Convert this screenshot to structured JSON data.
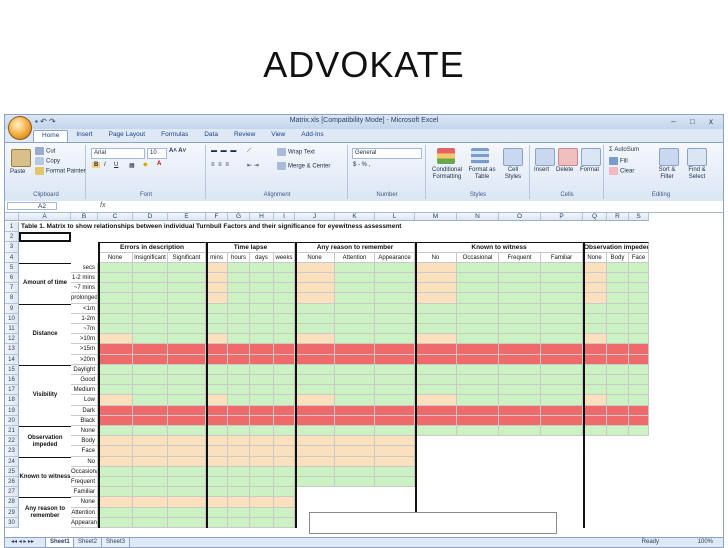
{
  "slide": {
    "title": "ADVOKATE"
  },
  "window": {
    "title": "Matrix.xls  [Compatibility Mode] - Microsoft Excel",
    "controls": "– □ x"
  },
  "ribbon": {
    "tabs": [
      "Home",
      "Insert",
      "Page Layout",
      "Formulas",
      "Data",
      "Review",
      "View",
      "Add-Ins"
    ],
    "clipboard": {
      "paste": "Paste",
      "cut": "Cut",
      "copy": "Copy",
      "format_painter": "Format Painter",
      "label": "Clipboard"
    },
    "font": {
      "name": "Arial",
      "size": "10",
      "label": "Font",
      "b": "B",
      "i": "I",
      "u": "U"
    },
    "alignment": {
      "wrap": "Wrap Text",
      "merge": "Merge & Center",
      "label": "Alignment"
    },
    "number": {
      "format": "General",
      "symbols": "$ - % ,",
      "label": "Number"
    },
    "styles": {
      "cond": "Conditional Formatting",
      "fmt_table": "Format as Table",
      "cell_styles": "Cell Styles",
      "label": "Styles"
    },
    "cells": {
      "insert": "Insert",
      "delete": "Delete",
      "format": "Format",
      "label": "Cells"
    },
    "editing": {
      "autosum": "AutoSum",
      "fill": "Fill",
      "clear": "Clear",
      "sort": "Sort & Filter",
      "find": "Find & Select",
      "label": "Editing"
    }
  },
  "formula_bar": {
    "cell_ref": "A2",
    "fx": "fx",
    "value": ""
  },
  "columns": [
    "A",
    "B",
    "C",
    "D",
    "E",
    "F",
    "G",
    "H",
    "I",
    "J",
    "K",
    "L",
    "M",
    "N",
    "O",
    "P",
    "Q",
    "R",
    "S"
  ],
  "sheet": {
    "table_title": "Table 1.  Matrix to show relationships between individual Turnbull Factors and their significance for eyewitness assessment",
    "groups": [
      {
        "label": "Errors in description",
        "subs": [
          "None",
          "Insignificant",
          "Significant"
        ]
      },
      {
        "label": "Time lapse",
        "subs": [
          "mins",
          "hours",
          "days",
          "weeks"
        ]
      },
      {
        "label": "Any reason to remember",
        "subs": [
          "None",
          "Attention",
          "Appearance"
        ]
      },
      {
        "label": "Known to witness",
        "subs": [
          "No",
          "Occasional",
          "Frequent",
          "Familiar"
        ]
      },
      {
        "label": "Observation impeded",
        "subs": [
          "None",
          "Body",
          "Face"
        ]
      }
    ],
    "factors": [
      {
        "label": "Amount of time",
        "rows": [
          "secs",
          "1-2 mins",
          "~7 mins",
          "prolonged"
        ]
      },
      {
        "label": "Distance",
        "rows": [
          "<1m",
          "1-2m",
          "~7m",
          ">10m",
          ">15m",
          ">20m"
        ]
      },
      {
        "label": "Visibility",
        "rows": [
          "Daylight",
          "Good",
          "Medium",
          "Low",
          "Dark",
          "Black"
        ]
      },
      {
        "label": "Observation impeded",
        "rows": [
          "None",
          "Body",
          "Face"
        ]
      },
      {
        "label": "Known to witness",
        "rows": [
          "No",
          "Occasional",
          "Frequent",
          "Familiar"
        ]
      },
      {
        "label": "Any reason to remember",
        "rows": [
          "None",
          "Attention",
          "Appearance"
        ]
      }
    ]
  },
  "sheet_tabs": [
    "Sheet1",
    "Sheet2",
    "Sheet3"
  ],
  "status": {
    "ready": "Ready",
    "zoom": "100%"
  },
  "colors": {
    "green": "#ccf2c4",
    "orange": "#fbe0bd",
    "red": "#ef6b6b"
  }
}
